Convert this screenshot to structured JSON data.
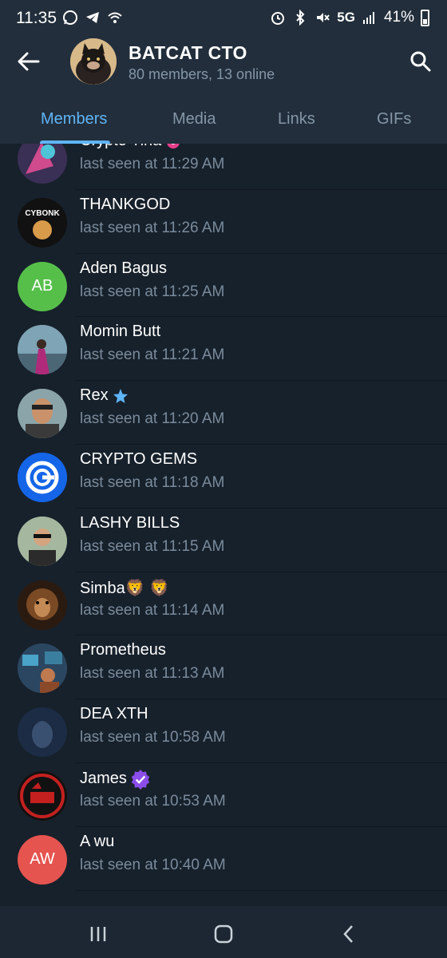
{
  "status_bar": {
    "time": "11:35",
    "network": "5G",
    "battery": "41%"
  },
  "header": {
    "title": "BATCAT CTO",
    "subtitle": "80 members, 13 online"
  },
  "tabs": [
    {
      "label": "Members",
      "active": true
    },
    {
      "label": "Media",
      "active": false
    },
    {
      "label": "Links",
      "active": false
    },
    {
      "label": "GIFs",
      "active": false
    }
  ],
  "members": [
    {
      "name": "Crypto Tina",
      "status": "last seen at 11:29 AM",
      "badge": "emoji-status-icon",
      "avatar_type": "image",
      "avatar_color": "#3a2f55"
    },
    {
      "name": "THANKGOD",
      "status": "last seen at 11:26 AM",
      "avatar_type": "image",
      "avatar_color": "#111111"
    },
    {
      "name": "Aden Bagus",
      "status": "last seen at 11:25 AM",
      "avatar_type": "initials",
      "initials": "AB",
      "avatar_color": "#56bf4a"
    },
    {
      "name": "Momin Butt",
      "status": "last seen at 11:21 AM",
      "avatar_type": "image",
      "avatar_color": "#5d7a8c"
    },
    {
      "name": "Rex",
      "status": "last seen at 11:20 AM",
      "badge": "star-icon",
      "avatar_type": "image",
      "avatar_color": "#6f8a91"
    },
    {
      "name": "CRYPTO GEMS",
      "status": "last seen at 11:18 AM",
      "avatar_type": "image",
      "avatar_color": "#1565e8"
    },
    {
      "name": "LASHY BILLS",
      "status": "last seen at 11:15 AM",
      "avatar_type": "image",
      "avatar_color": "#6b7d6a"
    },
    {
      "name": "Simba🦁 🦁",
      "status": "last seen at 11:14 AM",
      "avatar_type": "image",
      "avatar_color": "#3b2617"
    },
    {
      "name": "Prometheus",
      "status": "last seen at 11:13 AM",
      "avatar_type": "image",
      "avatar_color": "#2b4660"
    },
    {
      "name": "DEA XTH",
      "status": "last seen at 10:58 AM",
      "avatar_type": "image",
      "avatar_color": "#1c2c44"
    },
    {
      "name": "James",
      "status": "last seen at 10:53 AM",
      "badge": "verified-icon",
      "avatar_type": "image",
      "avatar_color": "#7a1414"
    },
    {
      "name": "A wu",
      "status": "last seen at 10:40 AM",
      "avatar_type": "initials",
      "initials": "AW",
      "avatar_color": "#e5544f"
    }
  ],
  "colors": {
    "background": "#17212b",
    "header": "#222e3b",
    "accent": "#5eb5f7",
    "muted_text": "#7a8b9c"
  }
}
